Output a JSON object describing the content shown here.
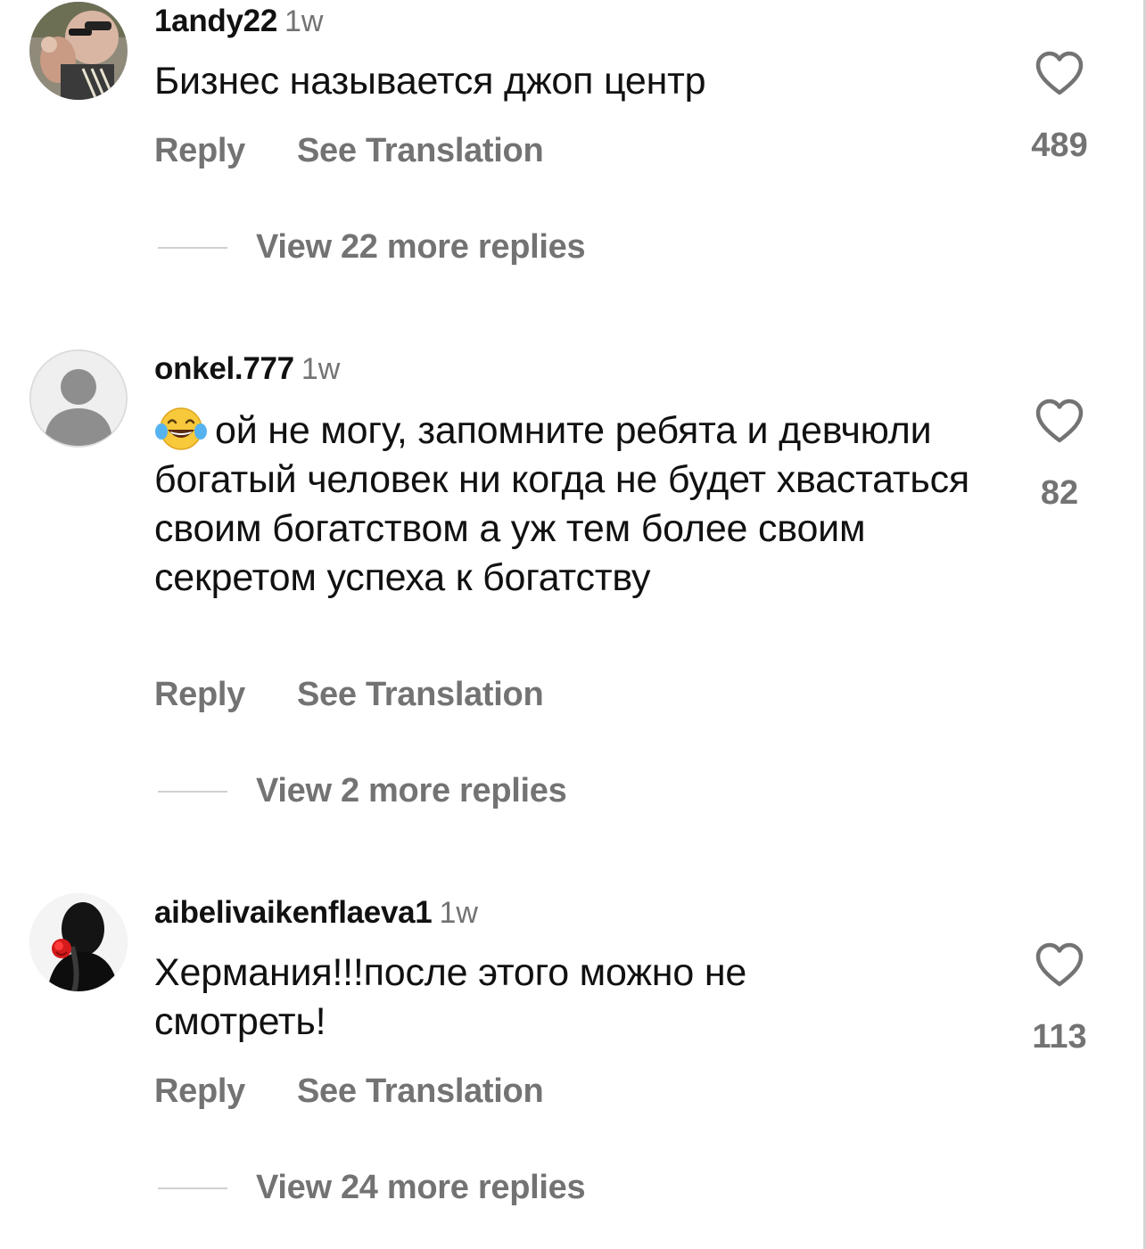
{
  "comments": [
    {
      "username": "1andy22",
      "time": "1w",
      "text": "Бизнес называется джоп центр",
      "reply_label": "Reply",
      "translate_label": "See Translation",
      "likes": "489",
      "view_replies": "View 22 more replies",
      "avatar": "user-photo-avatar"
    },
    {
      "username": "onkel.777",
      "time": "1w",
      "emoji": "tears-of-joy-emoji",
      "text": "ой не могу, запомните ребята и девчюли богатый человек ни когда не будет хвастаться своим богатством а уж тем более своим секретом успеха к богатству",
      "reply_label": "Reply",
      "translate_label": "See Translation",
      "likes": "82",
      "view_replies": "View 2 more replies",
      "avatar": "default-person-avatar"
    },
    {
      "username": "aibelivaikenflaeva1",
      "time": "1w",
      "text": "Хермания!!!после этого можно не смотреть!",
      "reply_label": "Reply",
      "translate_label": "See Translation",
      "likes": "113",
      "view_replies": "View 24 more replies",
      "avatar": "dark-photo-avatar-with-red-rose"
    }
  ],
  "colors": {
    "text": "#111111",
    "secondary": "#737373",
    "divider": "#d0d0d0",
    "background": "#ffffff"
  }
}
